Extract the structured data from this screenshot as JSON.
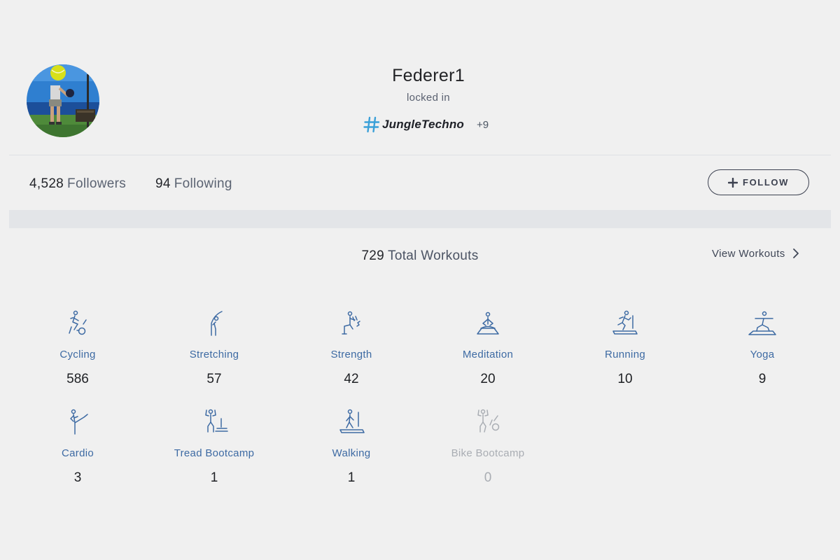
{
  "profile": {
    "username": "Federer1",
    "bio": "locked in",
    "tag": "JungleTechno",
    "tag_more": "+9",
    "avatar_icon": "avatar-photo",
    "hashtag_icon": "hashtag-icon"
  },
  "social": {
    "followers_count": "4,528",
    "followers_label": "Followers",
    "following_count": "94",
    "following_label": "Following",
    "follow_button": "FOLLOW"
  },
  "workouts": {
    "total_count": "729",
    "total_label": "Total Workouts",
    "view_link": "View Workouts",
    "categories": [
      {
        "label": "Cycling",
        "count": "586",
        "icon": "cycling-icon"
      },
      {
        "label": "Stretching",
        "count": "57",
        "icon": "stretching-icon"
      },
      {
        "label": "Strength",
        "count": "42",
        "icon": "strength-icon"
      },
      {
        "label": "Meditation",
        "count": "20",
        "icon": "meditation-icon"
      },
      {
        "label": "Running",
        "count": "10",
        "icon": "running-icon"
      },
      {
        "label": "Yoga",
        "count": "9",
        "icon": "yoga-icon"
      },
      {
        "label": "Cardio",
        "count": "3",
        "icon": "cardio-icon"
      },
      {
        "label": "Tread Bootcamp",
        "count": "1",
        "icon": "tread-bootcamp-icon"
      },
      {
        "label": "Walking",
        "count": "1",
        "icon": "walking-icon"
      },
      {
        "label": "Bike Bootcamp",
        "count": "0",
        "icon": "bike-bootcamp-icon"
      }
    ]
  },
  "colors": {
    "background": "#f0f0f0",
    "accent_blue": "#3d6aa3",
    "hashtag_blue": "#3aa0d8",
    "disabled_gray": "#a9adb3",
    "band_gray": "#e3e5e8"
  }
}
